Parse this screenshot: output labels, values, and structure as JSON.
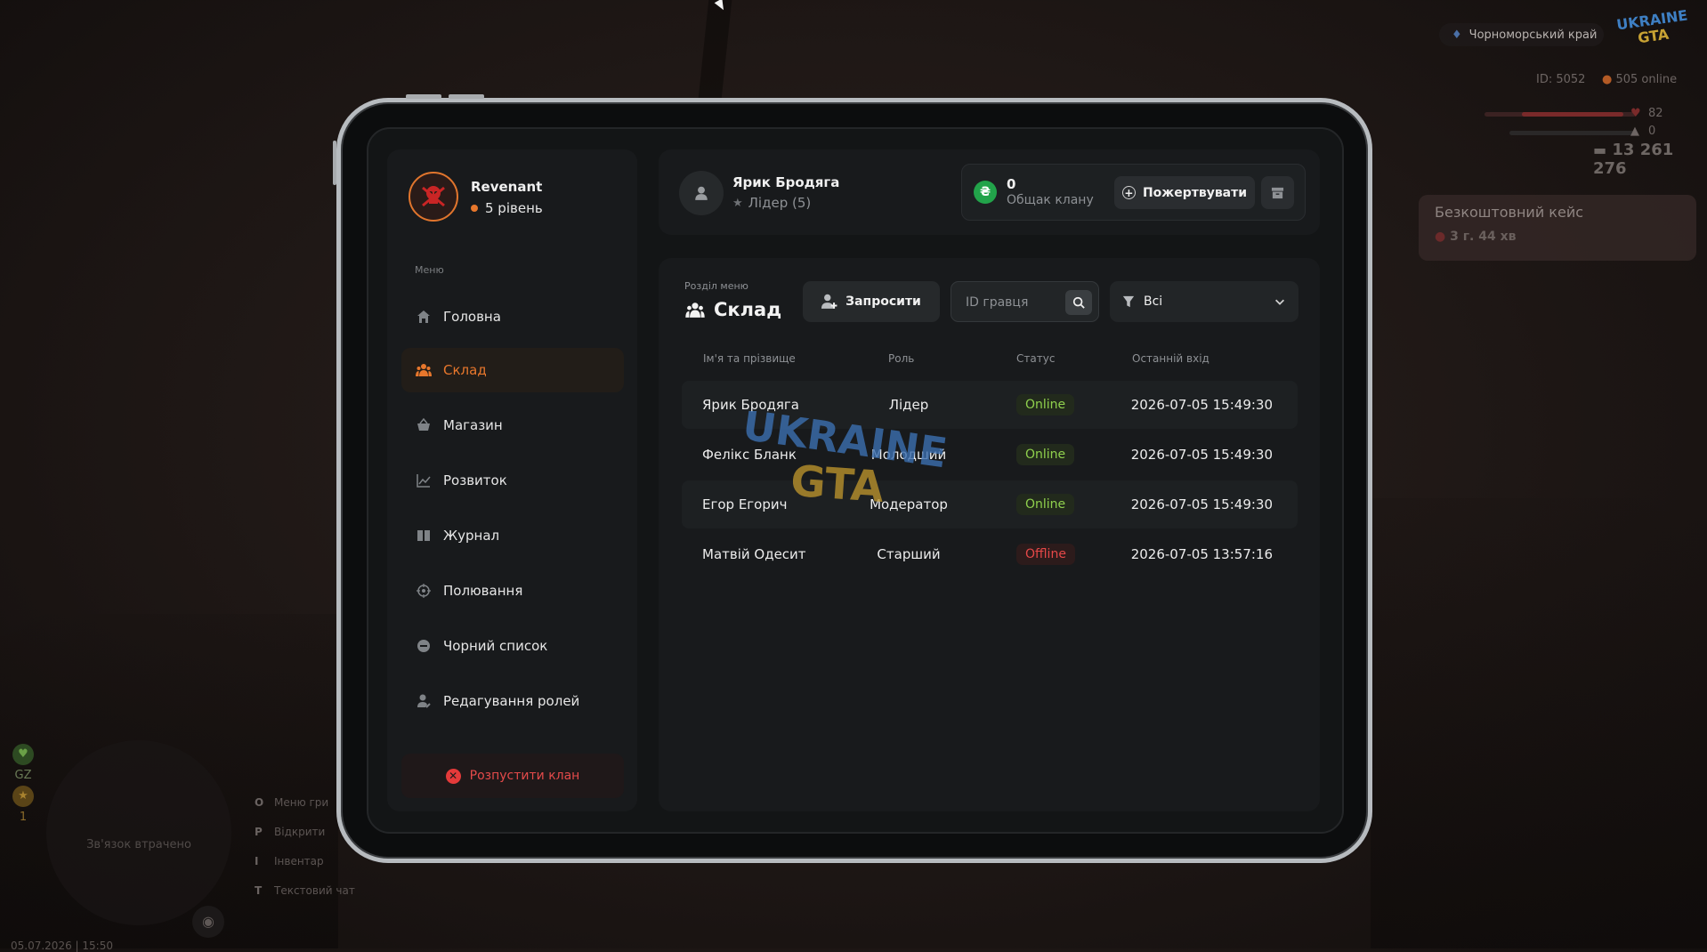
{
  "hud": {
    "region": "Чорноморський край",
    "logo_top": "UKRAINE",
    "logo_bottom": "GTA",
    "player_id": "ID: 5052",
    "online": "505 online",
    "health": "82",
    "armor": "0",
    "money": "13 261 276",
    "free_case_title": "Безкоштовний кейс",
    "free_case_timer": "3 г. 44 хв",
    "minimap_text": "Зв'язок втрачено",
    "gz_label": "GZ",
    "gz_value": "1",
    "keys": [
      {
        "key": "O",
        "label": "Меню гри"
      },
      {
        "key": "P",
        "label": "Відкрити"
      },
      {
        "key": "I",
        "label": "Інвентар"
      },
      {
        "key": "T",
        "label": "Текстовий чат"
      }
    ],
    "datetime": "05.07.2026 | 15:50"
  },
  "profile": {
    "clan_name": "Revenant",
    "level": "5 рівень"
  },
  "menu": {
    "caption": "Меню",
    "items": [
      {
        "label": "Головна",
        "icon": "home-icon"
      },
      {
        "label": "Склад",
        "icon": "users-icon"
      },
      {
        "label": "Магазин",
        "icon": "basket-icon"
      },
      {
        "label": "Розвиток",
        "icon": "chart-icon"
      },
      {
        "label": "Журнал",
        "icon": "book-icon"
      },
      {
        "label": "Полювання",
        "icon": "target-icon"
      },
      {
        "label": "Чорний список",
        "icon": "block-icon"
      },
      {
        "label": "Редагування ролей",
        "icon": "user-edit-icon"
      }
    ],
    "active": "Склад",
    "disband_label": "Розпустити клан"
  },
  "header": {
    "player_name": "Ярик Бродяга",
    "player_role": "Лідер (5)",
    "bank_value": "0",
    "bank_label": "Общак клану",
    "donate_label": "Пожертвувати"
  },
  "section": {
    "caption": "Розділ меню",
    "title": "Склад",
    "invite_label": "Запросити",
    "search_placeholder": "ID гравця",
    "filter_value": "Всі"
  },
  "table": {
    "columns": [
      "Ім'я та прізвище",
      "Роль",
      "Статус",
      "Останній вхід"
    ],
    "rows": [
      {
        "name": "Ярик Бродяга",
        "role": "Лідер",
        "status": "Online",
        "last": "2026-07-05 15:49:30"
      },
      {
        "name": "Фелікс Бланк",
        "role": "Молодший",
        "status": "Online",
        "last": "2026-07-05 15:49:30"
      },
      {
        "name": "Егор Егорич",
        "role": "Модератор",
        "status": "Online",
        "last": "2026-07-05 15:49:30"
      },
      {
        "name": "Матвій Одесит",
        "role": "Старший",
        "status": "Offline",
        "last": "2026-07-05 13:57:16"
      }
    ]
  },
  "colors": {
    "accent": "#e8772c",
    "online": "#8fd04d",
    "offline": "#e54848",
    "coin": "#22a34a"
  }
}
